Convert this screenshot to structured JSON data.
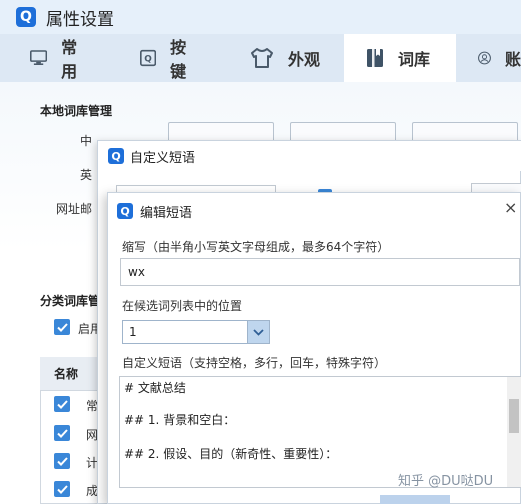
{
  "window": {
    "logo": "Q",
    "title": "属性设置"
  },
  "tabs": [
    {
      "label": "常用",
      "icon": "monitor-icon",
      "active": false
    },
    {
      "label": "按键",
      "icon": "key-icon",
      "active": false
    },
    {
      "label": "外观",
      "icon": "shirt-icon",
      "active": false
    },
    {
      "label": "词库",
      "icon": "book-icon",
      "active": true
    },
    {
      "label": "账",
      "icon": "user-icon",
      "active": false
    }
  ],
  "local_lexicon": {
    "title": "本地词库管理",
    "row_labels": [
      "中",
      "英",
      "网址邮"
    ]
  },
  "category_lexicon": {
    "title": "分类词库管",
    "enable_label": "启用",
    "column_name": "名称",
    "rows": [
      "常",
      "网",
      "计",
      "成"
    ]
  },
  "custom_phrase_dialog": {
    "logo": "Q",
    "title": "自定义短语"
  },
  "edit_phrase_dialog": {
    "logo": "Q",
    "title": "编辑短语",
    "close": "×",
    "abbr_label": "缩写（由半角小写英文字母组成，最多64个字符）",
    "abbr_value": "wx",
    "position_label": "在候选词列表中的位置",
    "position_value": "1",
    "phrase_label": "自定义短语（支持空格，多行，回车，特殊字符）",
    "phrase_lines": [
      "# 文献总结",
      "## 1. 背景和空白：",
      "## 2. 假设、目的（新奇性、重要性）："
    ]
  },
  "watermark": "知乎 @DU哒DU",
  "colors": {
    "accent": "#1e6fd9",
    "checkbox": "#3a87d8",
    "tab_bar": "#dde8f4"
  }
}
